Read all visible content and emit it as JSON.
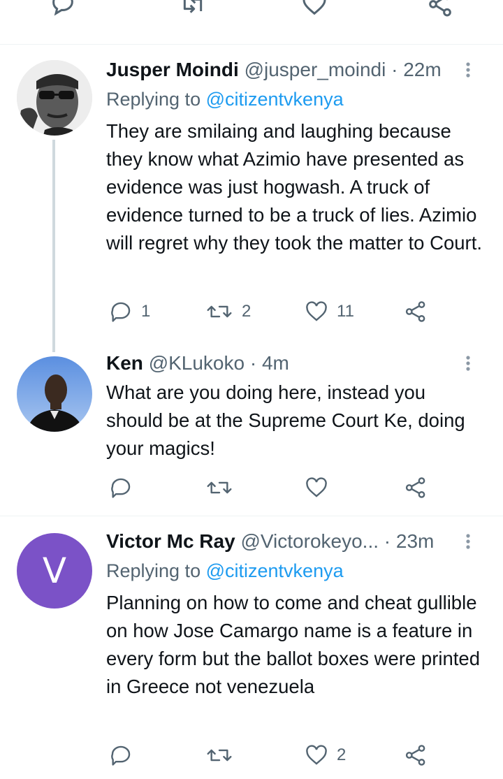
{
  "tweets": [
    {
      "name": "Jusper Moindi",
      "handle": "@jusper_moindi",
      "dot": "·",
      "time": "22m",
      "replying_prefix": "Replying to",
      "replying_to": "@citizentvkenya",
      "text": "They are smilaing and laughing because they know what Azimio have presented as evidence was just hogwash. A truck of evidence turned to be a truck of lies. Azimio will regret why they took the matter to Court.",
      "counts": {
        "reply": "1",
        "retweet": "2",
        "like": "11"
      }
    },
    {
      "name": "Ken",
      "handle": "@KLukoko",
      "dot": "·",
      "time": "4m",
      "text": "What are you doing here, instead you should be at the Supreme Court Ke, doing your magics!",
      "counts": {
        "reply": "",
        "retweet": "",
        "like": ""
      }
    },
    {
      "name": "Victor Mc Ray",
      "handle": "@Victorokeyo...",
      "dot": "·",
      "time": "23m",
      "avatar_letter": "V",
      "replying_prefix": "Replying to",
      "replying_to": "@citizentvkenya",
      "text": "Planning on how to come and cheat gullible on how Jose Camargo name is a feature in every form but the ballot boxes were printed in Greece not venezuela",
      "counts": {
        "reply": "",
        "retweet": "",
        "like": "2"
      }
    }
  ],
  "colors": {
    "text": "#0f1419",
    "secondary": "#536471",
    "link": "#1d9bf0",
    "thread_line": "#cfd9de",
    "avatar_v": "#7b52c7"
  }
}
